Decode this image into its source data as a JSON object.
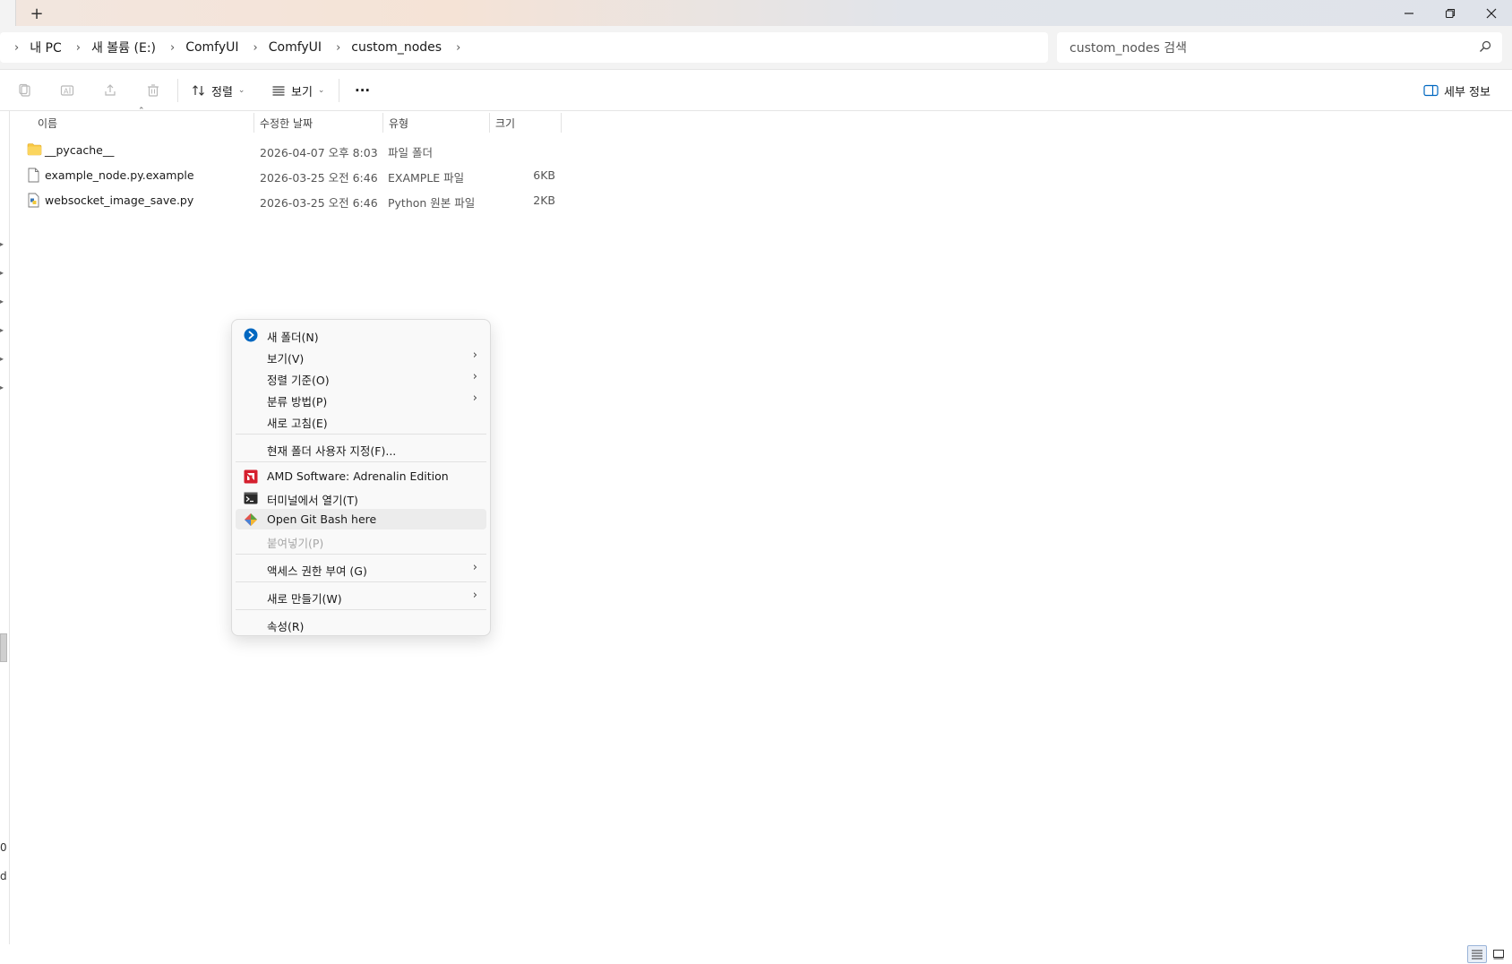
{
  "window": {
    "new_tab_label": "+",
    "minimize_glyph": "–",
    "maximize_glyph": "❐",
    "close_glyph": "✕"
  },
  "breadcrumb": {
    "items": [
      "내 PC",
      "새 볼륨 (E:)",
      "ComfyUI",
      "ComfyUI",
      "custom_nodes"
    ]
  },
  "search": {
    "placeholder": "custom_nodes 검색"
  },
  "toolbar": {
    "sort_label": "정렬",
    "view_label": "보기",
    "more_label": "···",
    "details_label": "세부 정보"
  },
  "columns": {
    "name": "이름",
    "modified": "수정한 날짜",
    "type": "유형",
    "size": "크기"
  },
  "files": [
    {
      "name": "__pycache__",
      "modified": "2026-04-07 오후 8:03",
      "type": "파일 폴더",
      "size": "",
      "icon": "folder-icon"
    },
    {
      "name": "example_node.py.example",
      "modified": "2026-03-25 오전 6:46",
      "type": "EXAMPLE 파일",
      "size": "6KB",
      "icon": "file-icon"
    },
    {
      "name": "websocket_image_save.py",
      "modified": "2026-03-25 오전 6:46",
      "type": "Python 원본 파일",
      "size": "2KB",
      "icon": "python-file-icon"
    }
  ],
  "context_menu": {
    "new_folder": "새 폴더(N)",
    "view": "보기(V)",
    "sort_by": "정렬 기준(O)",
    "group_by": "분류 방법(P)",
    "refresh": "새로 고침(E)",
    "customize": "현재 폴더 사용자 지정(F)...",
    "amd": "AMD Software: Adrenalin Edition",
    "terminal": "터미널에서 열기(T)",
    "git_bash": "Open Git Bash here",
    "paste": "붙여넣기(P)",
    "access": "액세스 권한 부여 (G)",
    "new": "새로 만들기(W)",
    "properties": "속성(R)"
  },
  "left_edge": {
    "char1": "0",
    "char2": "d"
  },
  "colors": {
    "accent": "#0067c0",
    "folder": "#f8c843",
    "amd_red": "#d5202e"
  }
}
